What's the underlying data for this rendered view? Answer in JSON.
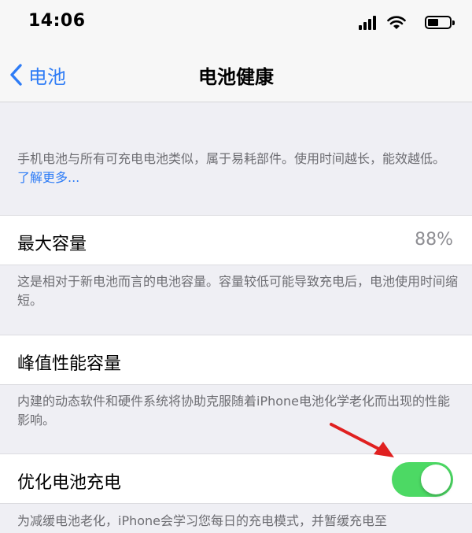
{
  "status_bar": {
    "time": "14:06",
    "icons": [
      "signal-icon",
      "wifi-icon",
      "battery-icon"
    ]
  },
  "nav": {
    "back_label": "电池",
    "title": "电池健康"
  },
  "intro": {
    "text": "手机电池与所有可充电电池类似，属于易耗部件。使用时间越长，能效越低。",
    "link": "了解更多..."
  },
  "max_capacity": {
    "label": "最大容量",
    "value": "88%",
    "footnote": "这是相对于新电池而言的电池容量。容量较低可能导致充电后，电池使用时间缩短。"
  },
  "peak_performance": {
    "label": "峰值性能容量",
    "footnote": "内建的动态软件和硬件系统将协助克服随着iPhone电池化学老化而出现的性能影响。"
  },
  "optimized_charging": {
    "label": "优化电池充电",
    "enabled": true,
    "footnote": "为减缓电池老化，iPhone会学习您每日的充电模式，并暂缓充电至"
  },
  "colors": {
    "accent": "#2e7cf6",
    "toggle_on": "#4cd964",
    "annotation_arrow": "#e02020",
    "background": "#efeff4"
  }
}
